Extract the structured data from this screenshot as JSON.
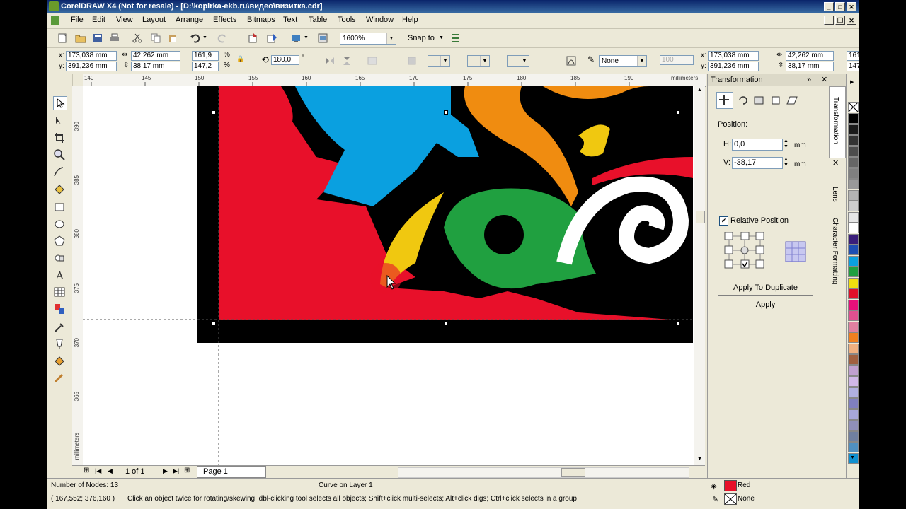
{
  "window": {
    "title": "CorelDRAW X4 (Not for resale) - [D:\\kopirka-ekb.ru\\видео\\визитка.cdr]"
  },
  "menu": [
    "File",
    "Edit",
    "View",
    "Layout",
    "Arrange",
    "Effects",
    "Bitmaps",
    "Text",
    "Table",
    "Tools",
    "Window",
    "Help"
  ],
  "toolbar": {
    "zoom": "1600%",
    "snap_to": "Snap to"
  },
  "property_bar": {
    "x": "173,038 mm",
    "y": "391,236 mm",
    "width": "42,262 mm",
    "height": "38,17 mm",
    "scale_x": "161,9",
    "scale_y": "147,2",
    "percent": "%",
    "rotation": "180,0",
    "rotation_unit": "°",
    "outline": "None",
    "opacity": "100",
    "x2": "173,038 mm",
    "y2": "391,236 mm",
    "width2": "42,262 mm",
    "height2": "38,17 mm",
    "extra1": "161",
    "extra2": "147",
    "x_label": "x:",
    "y_label": "y:"
  },
  "ruler": {
    "unit": "millimeters",
    "h_ticks": [
      "140",
      "145",
      "150",
      "155",
      "160",
      "165",
      "170",
      "175",
      "180",
      "185",
      "190"
    ],
    "v_ticks": [
      "390",
      "385",
      "380",
      "375",
      "370",
      "365"
    ],
    "v_unit": "millimeters"
  },
  "page_nav": {
    "count": "1 of 1",
    "tab": "Page 1"
  },
  "docker": {
    "title": "Transformation",
    "position_label": "Position:",
    "h_label": "H:",
    "h_value": "0,0",
    "v_label": "V:",
    "v_value": "-38,17",
    "unit": "mm",
    "relative_position": "Relative Position",
    "apply_duplicate": "Apply To Duplicate",
    "apply": "Apply"
  },
  "side_tabs": [
    "Transformation",
    "Lens",
    "Character Formatting"
  ],
  "palette": [
    "#000000",
    "#1a1a1a",
    "#333333",
    "#4d4d4d",
    "#666666",
    "#808080",
    "#999999",
    "#b3b3b3",
    "#cccccc",
    "#e6e6e6",
    "#ffffff",
    "#3a1e7a",
    "#1e4fb4",
    "#0aa0e0",
    "#20a040",
    "#f0e010",
    "#e0102a",
    "#e8107a",
    "#e05090",
    "#e080a0",
    "#f08020",
    "#f0b080",
    "#a06040",
    "#c0a0d0",
    "#d0b8e8",
    "#b0b0e0",
    "#8080c0",
    "#a8a8d8",
    "#9090b8",
    "#7080a0",
    "#5090c0",
    "#1090d0"
  ],
  "status": {
    "nodes": "Number of Nodes: 13",
    "layer": "Curve on Layer 1",
    "coords": "( 167,552; 376,160 )",
    "hint": "Click an object twice for rotating/skewing; dbl-clicking tool selects all objects; Shift+click multi-selects; Alt+click digs; Ctrl+click selects in a group",
    "fill_name": "Red",
    "fill_color": "#e8102a",
    "outline_name": "None"
  }
}
